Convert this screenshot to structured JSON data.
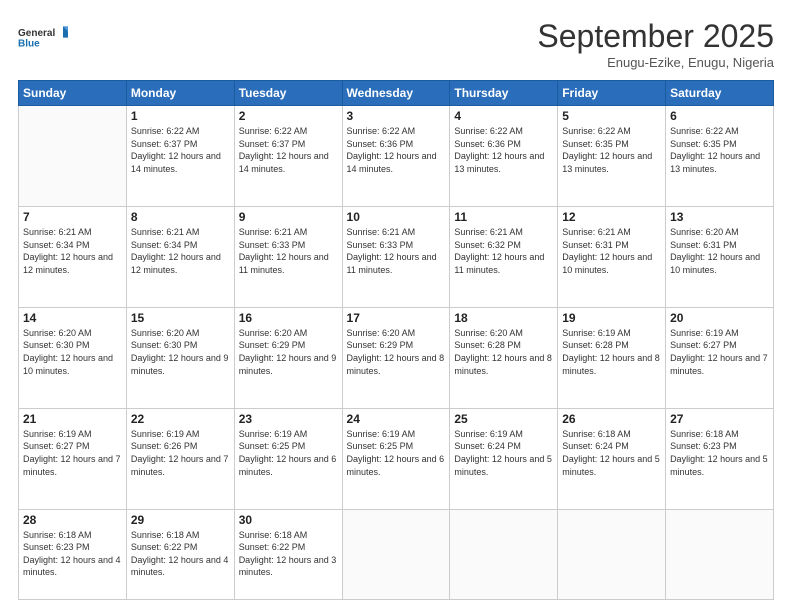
{
  "logo": {
    "line1": "General",
    "line2": "Blue"
  },
  "title": "September 2025",
  "subtitle": "Enugu-Ezike, Enugu, Nigeria",
  "days_of_week": [
    "Sunday",
    "Monday",
    "Tuesday",
    "Wednesday",
    "Thursday",
    "Friday",
    "Saturday"
  ],
  "weeks": [
    [
      {
        "day": "",
        "info": ""
      },
      {
        "day": "1",
        "info": "Sunrise: 6:22 AM\nSunset: 6:37 PM\nDaylight: 12 hours\nand 14 minutes."
      },
      {
        "day": "2",
        "info": "Sunrise: 6:22 AM\nSunset: 6:37 PM\nDaylight: 12 hours\nand 14 minutes."
      },
      {
        "day": "3",
        "info": "Sunrise: 6:22 AM\nSunset: 6:36 PM\nDaylight: 12 hours\nand 14 minutes."
      },
      {
        "day": "4",
        "info": "Sunrise: 6:22 AM\nSunset: 6:36 PM\nDaylight: 12 hours\nand 13 minutes."
      },
      {
        "day": "5",
        "info": "Sunrise: 6:22 AM\nSunset: 6:35 PM\nDaylight: 12 hours\nand 13 minutes."
      },
      {
        "day": "6",
        "info": "Sunrise: 6:22 AM\nSunset: 6:35 PM\nDaylight: 12 hours\nand 13 minutes."
      }
    ],
    [
      {
        "day": "7",
        "info": "Sunrise: 6:21 AM\nSunset: 6:34 PM\nDaylight: 12 hours\nand 12 minutes."
      },
      {
        "day": "8",
        "info": "Sunrise: 6:21 AM\nSunset: 6:34 PM\nDaylight: 12 hours\nand 12 minutes."
      },
      {
        "day": "9",
        "info": "Sunrise: 6:21 AM\nSunset: 6:33 PM\nDaylight: 12 hours\nand 11 minutes."
      },
      {
        "day": "10",
        "info": "Sunrise: 6:21 AM\nSunset: 6:33 PM\nDaylight: 12 hours\nand 11 minutes."
      },
      {
        "day": "11",
        "info": "Sunrise: 6:21 AM\nSunset: 6:32 PM\nDaylight: 12 hours\nand 11 minutes."
      },
      {
        "day": "12",
        "info": "Sunrise: 6:21 AM\nSunset: 6:31 PM\nDaylight: 12 hours\nand 10 minutes."
      },
      {
        "day": "13",
        "info": "Sunrise: 6:20 AM\nSunset: 6:31 PM\nDaylight: 12 hours\nand 10 minutes."
      }
    ],
    [
      {
        "day": "14",
        "info": "Sunrise: 6:20 AM\nSunset: 6:30 PM\nDaylight: 12 hours\nand 10 minutes."
      },
      {
        "day": "15",
        "info": "Sunrise: 6:20 AM\nSunset: 6:30 PM\nDaylight: 12 hours\nand 9 minutes."
      },
      {
        "day": "16",
        "info": "Sunrise: 6:20 AM\nSunset: 6:29 PM\nDaylight: 12 hours\nand 9 minutes."
      },
      {
        "day": "17",
        "info": "Sunrise: 6:20 AM\nSunset: 6:29 PM\nDaylight: 12 hours\nand 8 minutes."
      },
      {
        "day": "18",
        "info": "Sunrise: 6:20 AM\nSunset: 6:28 PM\nDaylight: 12 hours\nand 8 minutes."
      },
      {
        "day": "19",
        "info": "Sunrise: 6:19 AM\nSunset: 6:28 PM\nDaylight: 12 hours\nand 8 minutes."
      },
      {
        "day": "20",
        "info": "Sunrise: 6:19 AM\nSunset: 6:27 PM\nDaylight: 12 hours\nand 7 minutes."
      }
    ],
    [
      {
        "day": "21",
        "info": "Sunrise: 6:19 AM\nSunset: 6:27 PM\nDaylight: 12 hours\nand 7 minutes."
      },
      {
        "day": "22",
        "info": "Sunrise: 6:19 AM\nSunset: 6:26 PM\nDaylight: 12 hours\nand 7 minutes."
      },
      {
        "day": "23",
        "info": "Sunrise: 6:19 AM\nSunset: 6:25 PM\nDaylight: 12 hours\nand 6 minutes."
      },
      {
        "day": "24",
        "info": "Sunrise: 6:19 AM\nSunset: 6:25 PM\nDaylight: 12 hours\nand 6 minutes."
      },
      {
        "day": "25",
        "info": "Sunrise: 6:19 AM\nSunset: 6:24 PM\nDaylight: 12 hours\nand 5 minutes."
      },
      {
        "day": "26",
        "info": "Sunrise: 6:18 AM\nSunset: 6:24 PM\nDaylight: 12 hours\nand 5 minutes."
      },
      {
        "day": "27",
        "info": "Sunrise: 6:18 AM\nSunset: 6:23 PM\nDaylight: 12 hours\nand 5 minutes."
      }
    ],
    [
      {
        "day": "28",
        "info": "Sunrise: 6:18 AM\nSunset: 6:23 PM\nDaylight: 12 hours\nand 4 minutes."
      },
      {
        "day": "29",
        "info": "Sunrise: 6:18 AM\nSunset: 6:22 PM\nDaylight: 12 hours\nand 4 minutes."
      },
      {
        "day": "30",
        "info": "Sunrise: 6:18 AM\nSunset: 6:22 PM\nDaylight: 12 hours\nand 3 minutes."
      },
      {
        "day": "",
        "info": ""
      },
      {
        "day": "",
        "info": ""
      },
      {
        "day": "",
        "info": ""
      },
      {
        "day": "",
        "info": ""
      }
    ]
  ]
}
